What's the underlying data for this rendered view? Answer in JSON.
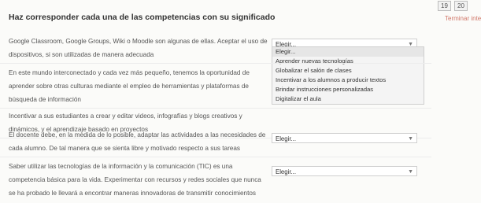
{
  "nav": {
    "pages": [
      "19",
      "20"
    ],
    "finish_label": "Terminar intent"
  },
  "question": {
    "title": "Haz corresponder cada una de las competencias con su significado"
  },
  "rows": [
    {
      "lines": [
        "Google Classroom, Google Groups, Wiki o Moodle son algunas de ellas. Aceptar el uso de",
        "dispositivos, si son utilizadas de manera adecuada"
      ],
      "select_value": "Elegir..."
    },
    {
      "lines": [
        "En este mundo interconectado y cada vez más pequeño, tenemos la oportunidad de",
        "aprender sobre otras culturas mediante el empleo de herramientas y plataformas de",
        "búsqueda de información"
      ],
      "select_value": ""
    },
    {
      "lines": [
        "Incentivar a sus estudiantes a crear y editar videos, infografías y blogs creativos y",
        "dinámicos, y el aprendizaje basado en proyectos"
      ],
      "select_value": ""
    },
    {
      "lines": [
        "El docente debe, en la medida de lo posible, adaptar las actividades a las necesidades de",
        "cada alumno. De tal manera que se sienta libre y motivado respecto a sus tareas"
      ],
      "select_value": "Elegir..."
    },
    {
      "lines": [
        "Saber utilizar las tecnologías de la información y la comunicación (TIC) es una",
        "competencia básica para la vida. Experimentar con recursos y redes sociales que nunca",
        "se ha probado le llevará a encontrar maneras innovadoras de transmitir conocimientos"
      ],
      "select_value": "Elegir..."
    }
  ],
  "dropdown": {
    "options": [
      "Elegir...",
      "Aprender nuevas tecnologías",
      "Globalizar el salón de clases",
      "Incentivar a los alumnos a producir textos",
      "Brindar instrucciones personalizadas",
      "Digitalizar el aula"
    ],
    "highlighted": "Elegir..."
  }
}
